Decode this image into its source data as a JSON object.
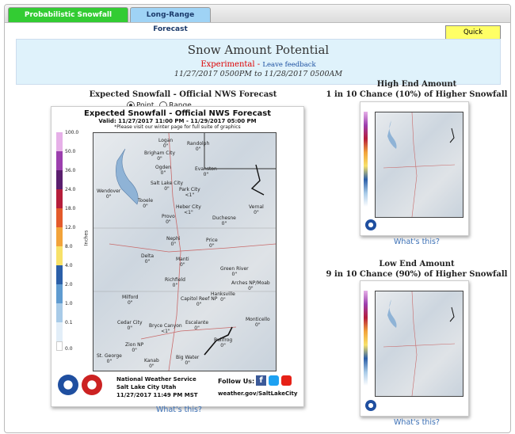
{
  "tabs": [
    {
      "label": "Probabilistic Snowfall Forecasts",
      "active": true
    },
    {
      "label": "Long-Range Forecast",
      "active": false
    }
  ],
  "quick_nav": "Quick Navigation",
  "header": {
    "title": "Snow Amount Potential",
    "experimental": "Experimental -",
    "feedback": "Leave feedback",
    "valid": "11/27/2017 0500PM to 11/28/2017 0500AM"
  },
  "main": {
    "section_title": "Expected Snowfall - Official NWS Forecast",
    "radio_point": "Point",
    "radio_range": "Range",
    "card_title": "Expected Snowfall - Official NWS Forecast",
    "card_valid": "Valid: 11/27/2017 11:00 PM - 11/29/2017 05:00 PM",
    "card_note": "*Please visit our winter page for full suite of graphics",
    "legend_unit": "Inches",
    "legend_ticks": [
      "100.0",
      "50.0",
      "36.0",
      "24.0",
      "18.0",
      "12.0",
      "8.0",
      "4.0",
      "2.0",
      "1.0",
      "0.1",
      "0.0"
    ],
    "cities": [
      {
        "name": "Logan",
        "value": "0\""
      },
      {
        "name": "Randolph",
        "value": "0\""
      },
      {
        "name": "Brigham City",
        "value": "0\""
      },
      {
        "name": "Ogden",
        "value": "0\""
      },
      {
        "name": "Evanston",
        "value": "0\""
      },
      {
        "name": "Salt Lake City",
        "value": "0\""
      },
      {
        "name": "Park City",
        "value": "<1\""
      },
      {
        "name": "Wendover",
        "value": "0\""
      },
      {
        "name": "Tooele",
        "value": "0\""
      },
      {
        "name": "Heber City",
        "value": "<1\""
      },
      {
        "name": "Provo",
        "value": "0\""
      },
      {
        "name": "Vernal",
        "value": "0\""
      },
      {
        "name": "Duchesne",
        "value": "0\""
      },
      {
        "name": "Nephi",
        "value": "0\""
      },
      {
        "name": "Price",
        "value": "0\""
      },
      {
        "name": "Delta",
        "value": "0\""
      },
      {
        "name": "Manti",
        "value": "0\""
      },
      {
        "name": "Green River",
        "value": "0\""
      },
      {
        "name": "Richfield",
        "value": "0\""
      },
      {
        "name": "Arches NP/Moab",
        "value": "0\""
      },
      {
        "name": "Milford",
        "value": "0\""
      },
      {
        "name": "Capitol Reef NP",
        "value": "0\""
      },
      {
        "name": "Hanksville",
        "value": "0\""
      },
      {
        "name": "Cedar City",
        "value": "0\""
      },
      {
        "name": "Bryce Canyon",
        "value": "<1\""
      },
      {
        "name": "Escalante",
        "value": "0\""
      },
      {
        "name": "Monticello",
        "value": "0\""
      },
      {
        "name": "Zion NP",
        "value": "0\""
      },
      {
        "name": "Bullfrog",
        "value": "0\""
      },
      {
        "name": "St. George",
        "value": "0\""
      },
      {
        "name": "Kanab",
        "value": "0\""
      },
      {
        "name": "Big Water",
        "value": "0\""
      }
    ],
    "footer_org": "National Weather Service",
    "footer_office": "Salt Lake City Utah",
    "footer_time": "11/27/2017 11:49 PM MST",
    "follow_us": "Follow Us:",
    "footer_url": "weather.gov/SaltLakeCity",
    "whats_this": "What's this?"
  },
  "high_end": {
    "title1": "High End Amount",
    "title2": "1 in 10 Chance (10%) of Higher Snowfall",
    "whats_this": "What's this?"
  },
  "low_end": {
    "title1": "Low End Amount",
    "title2": "9 in 10 Chance (90%) of Higher Snowfall",
    "whats_this": "What's this?"
  },
  "colors": {
    "tab_active": "#33cc33",
    "tab_inactive": "#9fd3f5",
    "header_bg": "#dff2fb",
    "quick_nav_bg": "#ffff66"
  }
}
